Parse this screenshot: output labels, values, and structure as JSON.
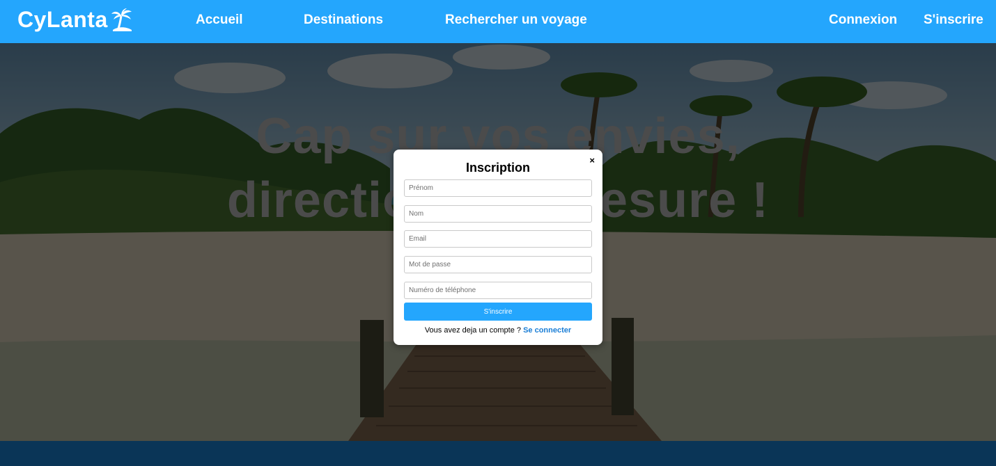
{
  "brand": {
    "name": "CyLanta",
    "icon": "palm-island-icon"
  },
  "nav": {
    "home": "Accueil",
    "destinations": "Destinations",
    "search": "Rechercher un voyage",
    "login": "Connexion",
    "signup": "S'inscrire"
  },
  "hero": {
    "title_line1": "Cap sur vos envies,",
    "title_line2": "direction sur mesure !"
  },
  "modal": {
    "title": "Inscription",
    "close": "×",
    "fields": {
      "firstname": "Prénom",
      "lastname": "Nom",
      "email": "Email",
      "password": "Mot de passe",
      "phone": "Numéro de téléphone"
    },
    "submit": "S'inscrire",
    "switch_text": "Vous avez deja un compte ? ",
    "switch_link": "Se connecter"
  },
  "colors": {
    "primary": "#24a6fd",
    "footer": "#0a3557",
    "link": "#1a7ed6"
  }
}
